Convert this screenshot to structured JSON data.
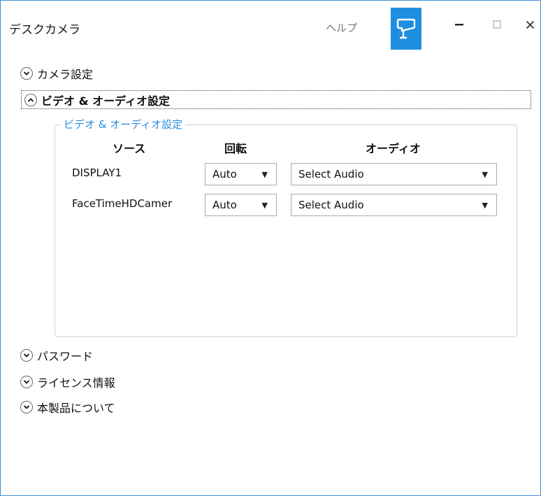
{
  "app": {
    "title": "デスクカメラ",
    "help": "ヘルプ"
  },
  "sections": {
    "camera_settings": "カメラ設定",
    "video_audio_settings": "ビデオ & オーディオ設定",
    "password": "パスワード",
    "license": "ライセンス情報",
    "about": "本製品について"
  },
  "group": {
    "legend": "ビデオ & オーディオ設定",
    "columns": {
      "source": "ソース",
      "rotation": "回転",
      "audio": "オーディオ"
    },
    "rows": [
      {
        "source": "DISPLAY1",
        "rotation": "Auto",
        "audio": "Select Audio"
      },
      {
        "source": "FaceTimeHDCamer",
        "rotation": "Auto",
        "audio": "Select Audio"
      }
    ]
  },
  "colors": {
    "accent": "#1e8fe0",
    "legend_text": "#2a8be0",
    "window_border": "#3f8fd6"
  },
  "icons": {
    "camera": "security-camera-icon",
    "minimize": "minimize-icon",
    "maximize": "maximize-icon",
    "close": "close-icon",
    "collapsed": "chevron-down-icon",
    "expanded": "chevron-up-icon"
  }
}
